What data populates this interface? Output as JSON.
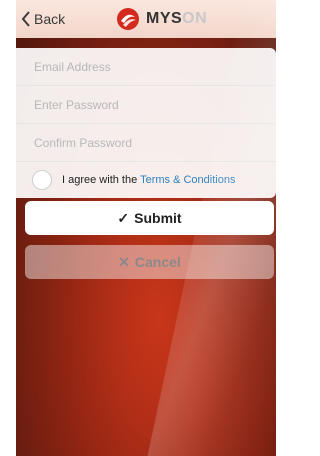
{
  "nav": {
    "back_label": "Back",
    "brand_part1": "MYS",
    "brand_part2": "ON"
  },
  "form": {
    "email_placeholder": "Email Address",
    "password_placeholder": "Enter Password",
    "confirm_placeholder": "Confirm Password",
    "agree_prefix": "I agree with the ",
    "terms_link": "Terms & Conditions",
    "agree_checked": false
  },
  "buttons": {
    "submit_label": "Submit",
    "submit_icon": "checkmark-icon",
    "cancel_label": "Cancel",
    "cancel_icon": "x-icon"
  },
  "colors": {
    "accent_link": "#2f7fc0",
    "logo_red": "#d42a1e"
  }
}
